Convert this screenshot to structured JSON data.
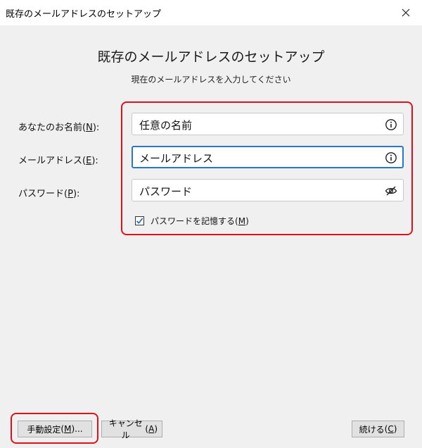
{
  "window": {
    "title": "既存のメールアドレスのセットアップ",
    "close_glyph": "✕"
  },
  "header": {
    "title": "既存のメールアドレスのセットアップ",
    "subtitle": "現在のメールアドレスを入力してください"
  },
  "form": {
    "name": {
      "label": "あなたのお名前",
      "accesskey": "N",
      "value": "任意の名前",
      "icon": "info-icon"
    },
    "email": {
      "label": "メールアドレス",
      "accesskey": "E",
      "value": "メールアドレス",
      "icon": "info-icon"
    },
    "password": {
      "label": "パスワード",
      "accesskey": "P",
      "value": "パスワード",
      "icon": "eye-slash-icon"
    },
    "remember": {
      "label": "パスワードを記憶する",
      "accesskey": "M",
      "checked": true
    }
  },
  "buttons": {
    "manual": {
      "label": "手動設定",
      "accesskey": "M",
      "suffix": "..."
    },
    "cancel": {
      "label": "キャンセル",
      "accesskey": "A"
    },
    "continue": {
      "label": "続ける",
      "accesskey": "C"
    }
  },
  "colors": {
    "highlight": "#e0101a",
    "focus": "#2a77c9",
    "checkmark": "#1f5fb8"
  }
}
